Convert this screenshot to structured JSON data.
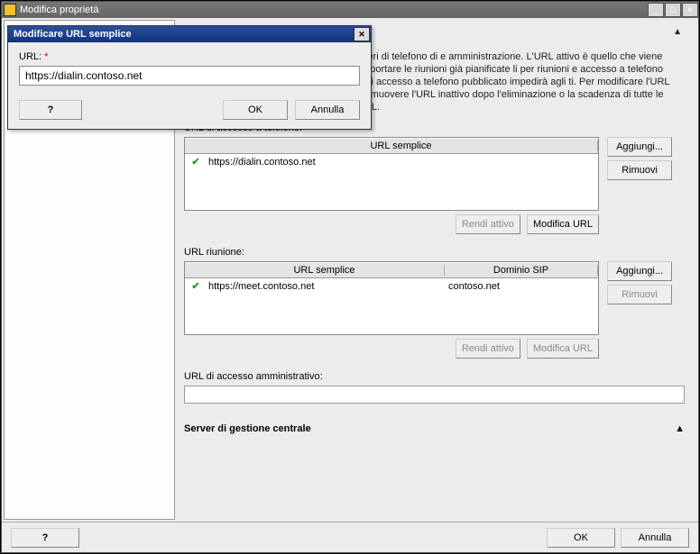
{
  "main_window": {
    "title": "Modifica proprietà"
  },
  "help_text": "ti per accedere alle pagine Web per i numeri di telefono di e amministrazione. L'URL attivo è quello che viene utilizzato al URL vengono utilizzati per supportare le riunioni già pianificate li per riunioni e accesso a telefono sono necessari e devono URL riunione o di accesso a telefono pubblicato impedirà agli ti. Per modificare l'URL attivo, è necessario creare un nuovo bile rimuovere l'URL inattivo dopo l'eliminazione o la scadenza di tutte le riunioni e conferenze che utilizzano tali URL.",
  "dialin": {
    "label": "URL di accesso a telefono:",
    "header": "URL semplice",
    "row_url": "https://dialin.contoso.net",
    "add": "Aggiungi...",
    "remove": "Rimuovi",
    "make_active": "Rendi attivo",
    "edit_url": "Modifica URL"
  },
  "meeting": {
    "label": "URL riunione:",
    "header_url": "URL semplice",
    "header_sip": "Dominio SIP",
    "row_url": "https://meet.contoso.net",
    "row_sip": "contoso.net",
    "add": "Aggiungi...",
    "remove": "Rimuovi",
    "make_active": "Rendi attivo",
    "edit_url": "Modifica URL"
  },
  "admin": {
    "label": "URL di accesso amministrativo:",
    "value": ""
  },
  "central_server": "Server di gestione centrale",
  "footer": {
    "help": "?",
    "ok": "OK",
    "cancel": "Annulla"
  },
  "modal": {
    "title": "Modificare URL semplice",
    "url_label": "URL:",
    "url_value": "https://dialin.contoso.net",
    "help": "?",
    "ok": "OK",
    "cancel": "Annulla"
  }
}
